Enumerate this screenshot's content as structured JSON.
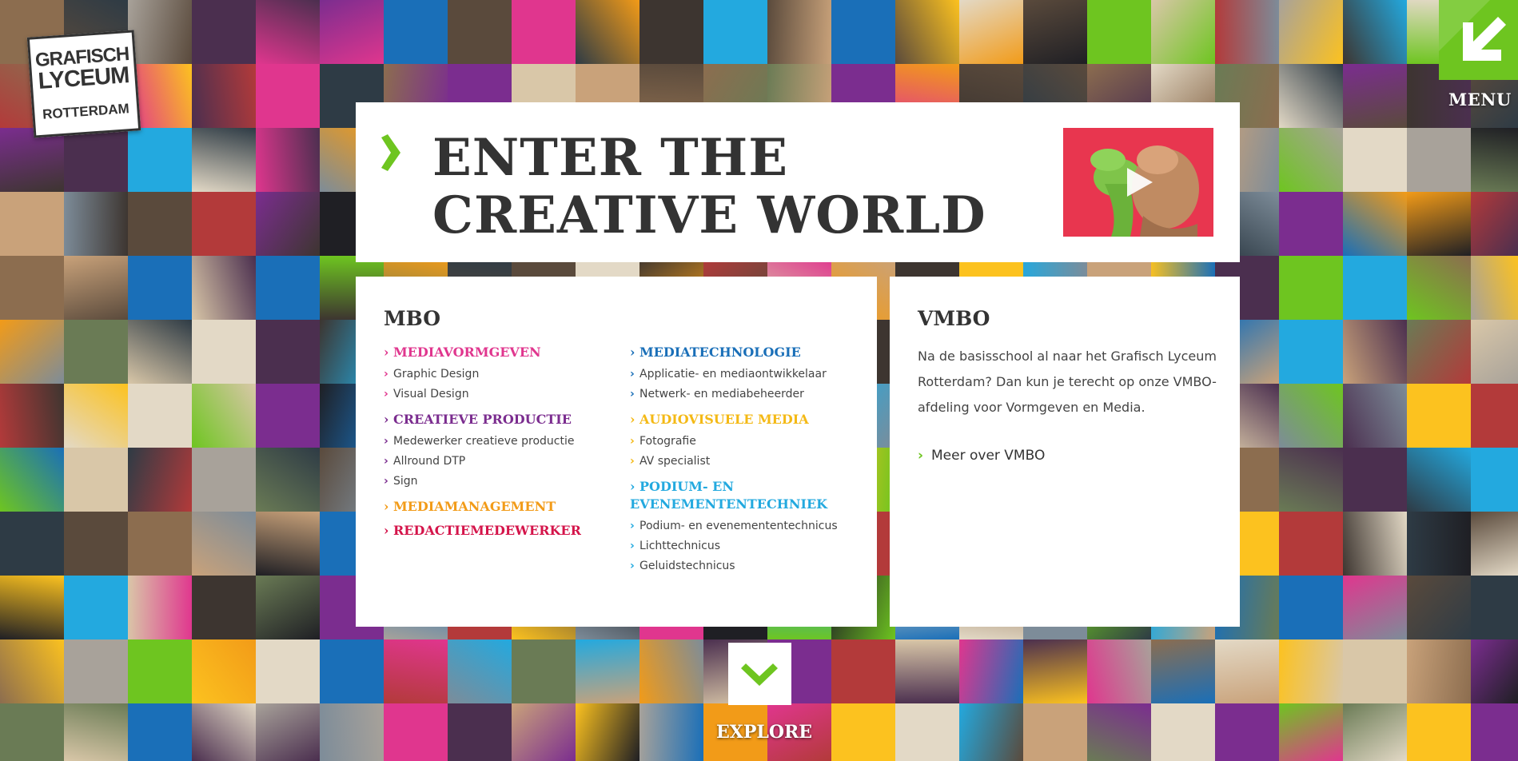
{
  "logo": {
    "line1": "GRAFISCH",
    "line2": "LYCEUM",
    "line3": "ROTTERDAM"
  },
  "menu": {
    "label": "MENU"
  },
  "hero": {
    "title_line1": "ENTER THE",
    "title_line2": "CREATIVE WORLD",
    "video_icon": "play-icon"
  },
  "mbo": {
    "heading": "MBO",
    "left_column": [
      {
        "label": "MEDIAVORMGEVEN",
        "color": "#e0368e",
        "items": [
          "Graphic Design",
          "Visual Design"
        ]
      },
      {
        "label": "CREATIEVE PRODUCTIE",
        "color": "#7b2d8f",
        "items": [
          "Medewerker creatieve productie",
          "Allround DTP",
          "Sign"
        ]
      },
      {
        "label": "MEDIAMANAGEMENT",
        "color": "#f29b18",
        "items": []
      },
      {
        "label": "REDACTIEMEDEWERKER",
        "color": "#d4144a",
        "items": []
      }
    ],
    "right_column": [
      {
        "label": "MEDIATECHNOLOGIE",
        "color": "#1a6fb8",
        "items": [
          "Applicatie- en mediaontwikkelaar",
          "Netwerk- en mediabeheerder"
        ]
      },
      {
        "label": "AUDIOVISUELE MEDIA",
        "color": "#f4b915",
        "items": [
          "Fotografie",
          "AV specialist"
        ]
      },
      {
        "label": "PODIUM- EN EVENEMENTENTECHNIEK",
        "color": "#23a9df",
        "items": [
          "Podium- en evenemententechnicus",
          "Lichttechnicus",
          "Geluidstechnicus"
        ]
      }
    ]
  },
  "vmbo": {
    "heading": "VMBO",
    "text": "Na de basisschool al naar het Grafisch Lyceum Rotterdam? Dan kun je terecht op onze VMBO-afdeling voor Vormgeven en Media.",
    "link_label": "Meer over VMBO"
  },
  "explore": {
    "label": "EXPLORE",
    "icon": "chevron-down-icon"
  },
  "colors": {
    "accent_green": "#6ec520",
    "text_dark": "#333333",
    "yellow": "#fcc21f",
    "magenta": "#e0368e",
    "purple": "#7b2d8f",
    "blue": "#1a6fb8",
    "cyan": "#23a9df"
  }
}
